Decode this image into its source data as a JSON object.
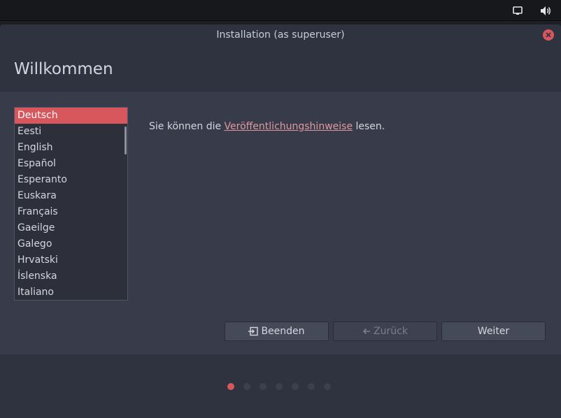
{
  "panel": {
    "display_icon": "display-icon",
    "volume_icon": "volume-icon"
  },
  "window": {
    "title": "Installation (as superuser)",
    "close_icon": "close-icon"
  },
  "header": {
    "title": "Willkommen"
  },
  "languages": {
    "items": [
      "Deutsch",
      "Eesti",
      "English",
      "Español",
      "Esperanto",
      "Euskara",
      "Français",
      "Gaeilge",
      "Galego",
      "Hrvatski",
      "Íslenska",
      "Italiano"
    ],
    "selected": "Deutsch"
  },
  "release_notes": {
    "prefix": "Sie können die ",
    "link": "Veröffentlichungshinweise",
    "suffix": " lesen."
  },
  "buttons": {
    "quit": "Beenden",
    "back": "Zurück",
    "forward": "Weiter"
  },
  "progress": {
    "total_steps": 7,
    "current_step": 1
  },
  "colors": {
    "accent": "#d7575d",
    "background": "#383c4a",
    "link": "#e0999c"
  }
}
